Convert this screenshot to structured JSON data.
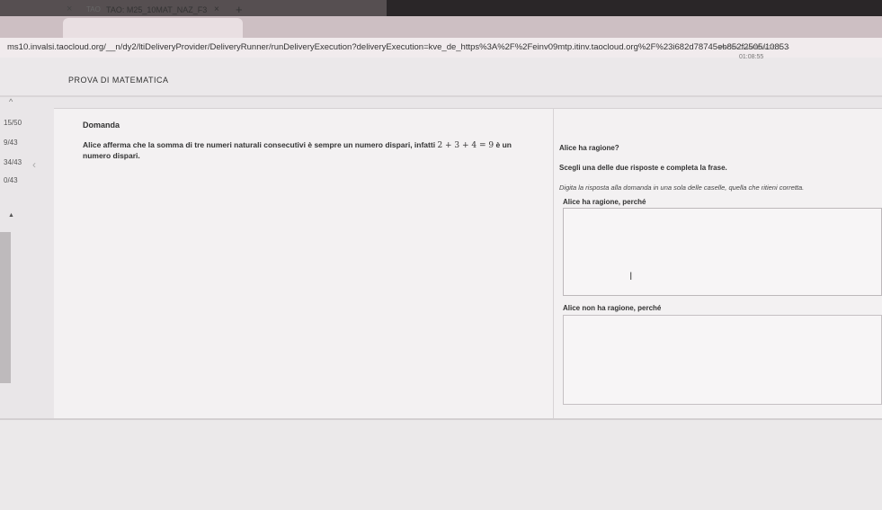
{
  "browser": {
    "tab_title": "TAO: M25_10MAT_NAZ_F3",
    "tab_favicon": "TAO",
    "tab_close_left": "×",
    "tab_close": "×",
    "new_tab": "+",
    "url": "ms10.invalsi.taocloud.org/__n/dy2/ltiDeliveryProvider/DeliveryRunner/runDeliveryExecution?deliveryExecution=kve_de_https%3A%2F%2Feinv09mtp.itinv.taocloud.org%2F%23i682d78745eb852f2505/10853497f52282"
  },
  "header": {
    "title": "PROVA DI MATEMATICA",
    "timer_label": "PROVA DI MATEMATICA",
    "timer": "01:08:55"
  },
  "progress": {
    "collapse": "^",
    "items": [
      "15/50",
      "9/43",
      "34/43",
      "0/43"
    ],
    "side_arrow": "‹",
    "scroll_up": "▲"
  },
  "question": {
    "heading": "Domanda",
    "text_before": "Alice afferma che la somma di tre numeri naturali consecutivi è sempre un numero dispari, infatti",
    "math": "2 + 3 + 4 = 9",
    "text_after": "è un",
    "text_line2": "numero dispari."
  },
  "answer": {
    "question": "Alice ha ragione?",
    "instruction": "Scegli una delle due risposte e completa la frase.",
    "hint": "Digita la risposta alla domanda in una sola delle caselle, quella che ritieni corretta.",
    "option1_label": "Alice ha ragione, perché",
    "option1_value": "",
    "option2_label": "Alice non ha ragione, perché",
    "option2_value": "",
    "cursor": "I"
  }
}
